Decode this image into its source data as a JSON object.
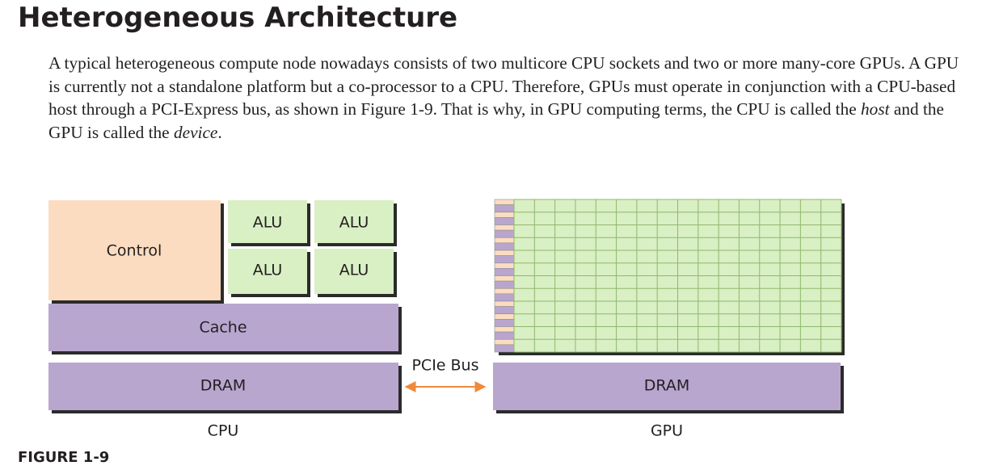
{
  "heading": "Heterogeneous Architecture",
  "paragraph": {
    "part1": "A typical heterogeneous compute node nowadays consists of two multicore CPU sockets and two or more many-core GPUs. A GPU is currently not a standalone platform but a co-processor to a CPU. Therefore, GPUs must operate in conjunction with a CPU-based host through a PCI-Express bus, as shown in Figure 1-9. That is why, in GPU computing terms, the CPU is called the ",
    "host": "host",
    "part2": " and the GPU is called the ",
    "device": "device",
    "part3": "."
  },
  "figure": {
    "cpu": {
      "control_label": "Control",
      "alu_labels": [
        "ALU",
        "ALU",
        "ALU",
        "ALU"
      ],
      "cache_label": "Cache",
      "dram_label": "DRAM",
      "caption": "CPU"
    },
    "gpu": {
      "dram_label": "DRAM",
      "caption": "GPU",
      "grid_rows": 12,
      "grid_cols": 16
    },
    "bus_label": "PCIe Bus",
    "colors": {
      "control": "#fcdcc0",
      "alu": "#d9efc4",
      "memory": "#b9a6cf",
      "grid_cell": "#d9efc4",
      "grid_line": "#8fb86c",
      "arrow": "#ef8a3c",
      "shadow": "#2b2b2b"
    }
  },
  "figure_caption": "FIGURE 1-9"
}
